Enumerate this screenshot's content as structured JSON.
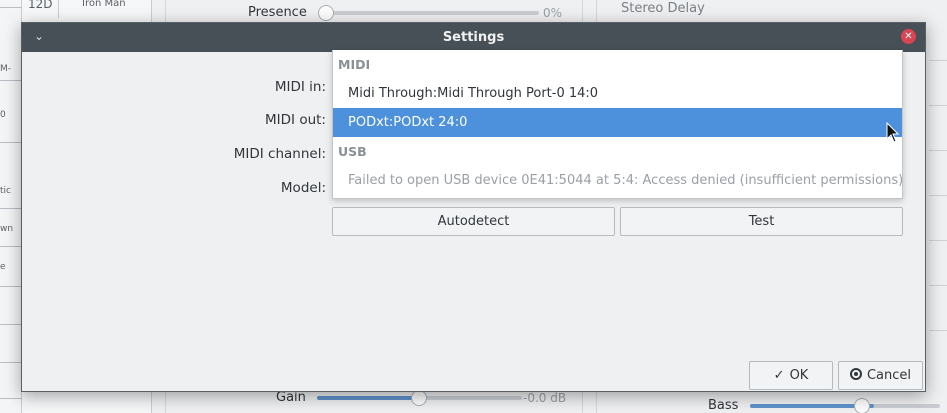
{
  "background": {
    "left_column": [
      "M-",
      "0",
      "tic",
      "wn",
      "e"
    ],
    "list_header": [
      "12D",
      "Iron Man"
    ],
    "presence": {
      "label": "Presence",
      "value": "0%",
      "level": 0.0
    },
    "gain": {
      "label": "Gain",
      "value": "-0.0 dB",
      "level": 0.5
    },
    "effect_name": "Stereo Delay",
    "bass": {
      "label": "Bass",
      "level": 0.65
    }
  },
  "dialog": {
    "title": "Settings",
    "labels": {
      "midi_in": "MIDI in:",
      "midi_out": "MIDI out:",
      "midi_channel": "MIDI channel:",
      "model": "Model:"
    },
    "buttons": {
      "autodetect": "Autodetect",
      "test": "Test",
      "ok": "OK",
      "cancel": "Cancel"
    },
    "midi_in_dropdown": {
      "sections": [
        {
          "header": "MIDI",
          "items": [
            {
              "label": "Midi Through:Midi Through Port-0 14:0",
              "selected": false,
              "disabled": false
            },
            {
              "label": "PODxt:PODxt 24:0",
              "selected": true,
              "disabled": false
            }
          ]
        },
        {
          "header": "USB",
          "items": [
            {
              "label": "Failed to open USB device 0E41:5044 at 5:4: Access denied (insufficient permissions)",
              "selected": false,
              "disabled": true
            }
          ]
        }
      ]
    }
  },
  "colors": {
    "titlebar": "#475057",
    "selection": "#4d90db",
    "close": "#da4453",
    "slider_fill": "#5f93cc"
  },
  "icons": {
    "window_menu": "chevron-down-icon",
    "close": "close-icon",
    "ok": "check-icon",
    "cancel": "cancel-icon",
    "cursor": "mouse-pointer-icon"
  }
}
